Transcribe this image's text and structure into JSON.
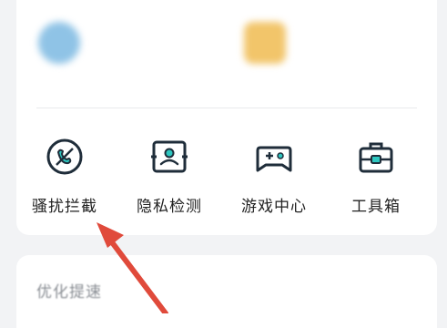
{
  "features": {
    "left": {
      "title": "",
      "subtitle": ""
    },
    "right": {
      "title": "",
      "subtitle": ""
    }
  },
  "tools": [
    {
      "label": "骚扰拦截",
      "icon": "phone-shield-icon"
    },
    {
      "label": "隐私检测",
      "icon": "privacy-scan-icon"
    },
    {
      "label": "游戏中心",
      "icon": "gamepad-icon"
    },
    {
      "label": "工具箱",
      "icon": "toolbox-icon"
    }
  ],
  "section": {
    "title": "优化提速"
  },
  "colors": {
    "icon_dark": "#1f2d3a",
    "icon_accent": "#2ec7c0",
    "arrow": "#e04a3b"
  }
}
